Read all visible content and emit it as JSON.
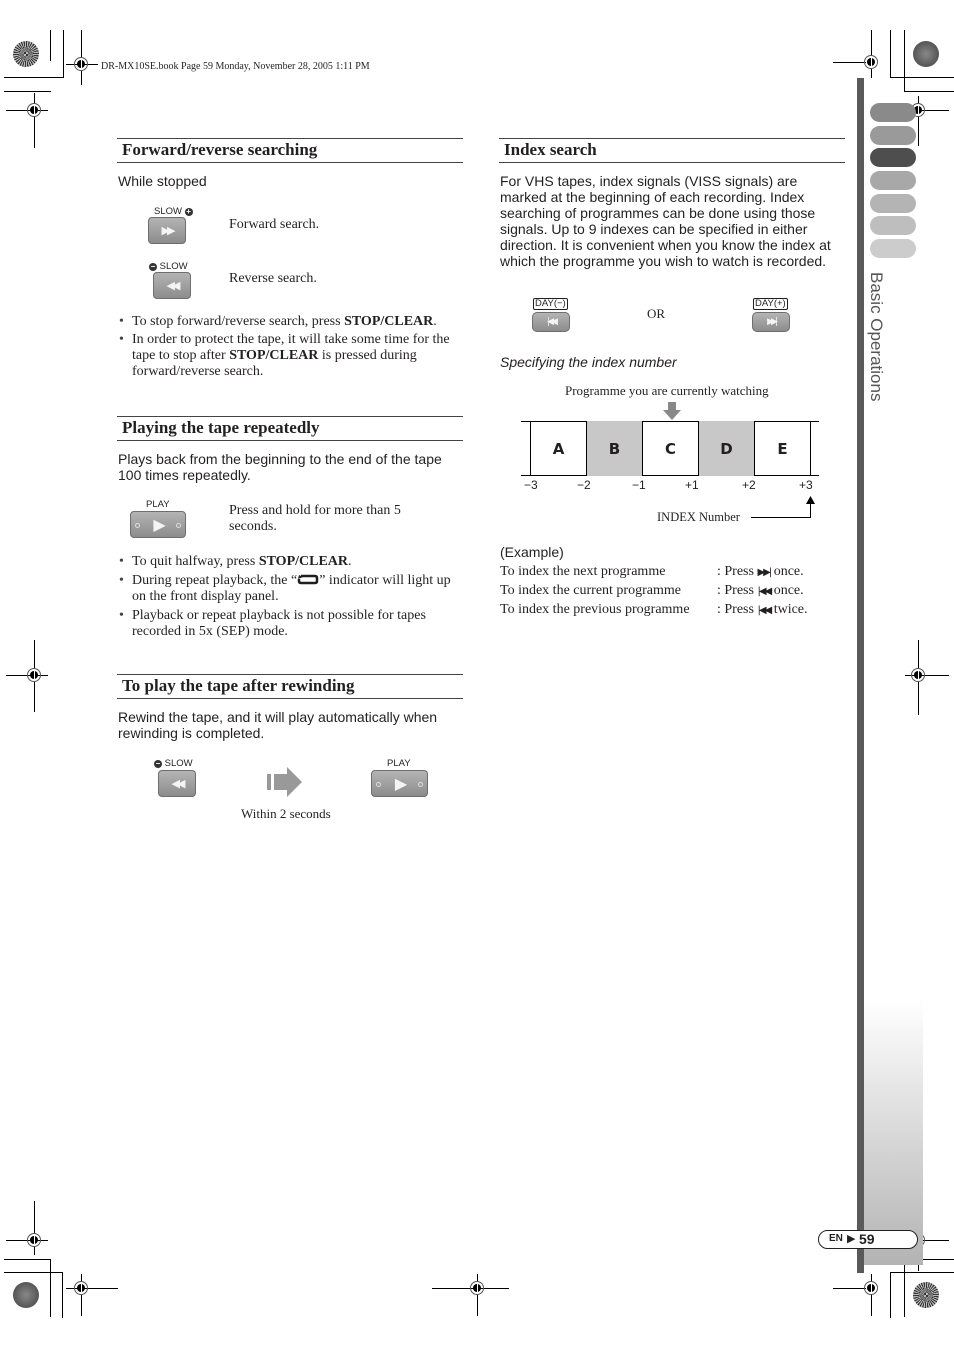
{
  "book_header": "DR-MX10SE.book  Page 59  Monday, November 28, 2005  1:11 PM",
  "side_tab": {
    "title": "Basic Operations",
    "pill_colors": [
      "#8a8a8a",
      "#9a9a9a",
      "#4e4e4e",
      "#a8a8a8",
      "#b4b4b4",
      "#bebebe",
      "#cccccc"
    ]
  },
  "page_footer": {
    "lang": "EN",
    "arrow": "▶",
    "page": "59"
  },
  "forward_reverse": {
    "heading": "Forward/reverse searching",
    "intro": "While stopped",
    "buttons": [
      {
        "label": "SLOW",
        "sign": "+",
        "glyph": "▶▶",
        "description": "Forward search."
      },
      {
        "label": "SLOW",
        "sign": "−",
        "glyph": "◀◀",
        "description": "Reverse search."
      }
    ],
    "notes": [
      {
        "pre": "To stop forward/reverse search, press ",
        "kw": "STOP/CLEAR",
        "post": "."
      },
      {
        "pre": "In order to protect the tape, it will take some time for the tape to stop after ",
        "kw": "STOP/CLEAR",
        "post": " is pressed during forward/reverse search."
      }
    ]
  },
  "repeat": {
    "heading": "Playing the tape repeatedly",
    "intro": "Plays back from the beginning to the end of the tape 100 times repeatedly.",
    "button": {
      "label": "PLAY",
      "glyph": "▶",
      "description": "Press and hold for more than 5 seconds."
    },
    "notes": [
      {
        "pre": "To quit halfway, press ",
        "kw": "STOP/CLEAR",
        "post": "."
      },
      {
        "pre": "During repeat playback, the “",
        "icon": "repeat-icon",
        "post": "” indicator will light up on the front display panel."
      },
      {
        "pre": "Playback or repeat playback is not possible for tapes recorded in 5x (SEP) mode."
      }
    ]
  },
  "after_rewind": {
    "heading": "To play the tape after rewinding",
    "intro": "Rewind the tape, and it will play automatically when rewinding is completed.",
    "rewind_button": {
      "label": "SLOW",
      "sign": "−",
      "glyph": "◀◀"
    },
    "play_button": {
      "label": "PLAY",
      "glyph": "▶"
    },
    "caption": "Within 2 seconds"
  },
  "index_search": {
    "heading": "Index search",
    "intro": "For VHS tapes, index signals (VISS signals) are marked at the beginning of each recording. Index searching of programmes can be done using those signals. Up to 9 indexes can be specified in either direction. It is convenient when you know the index at which the programme you wish to watch is recorded.",
    "prev_button": {
      "label": "DAY(−)",
      "glyph": "|◀◀"
    },
    "or_label": "OR",
    "next_button": {
      "label": "DAY(+)",
      "glyph": "▶▶|"
    },
    "subheading": "Specifying the index number",
    "diagram": {
      "current_label": "Programme you are currently watching",
      "programmes": [
        "A",
        "B",
        "C",
        "D",
        "E"
      ],
      "shaded": [
        false,
        true,
        false,
        true,
        false
      ],
      "index_numbers": [
        "−3",
        "−2",
        "−1",
        "+1",
        "+2",
        "+3"
      ],
      "index_label": "INDEX Number"
    },
    "example": {
      "title": "(Example)",
      "rows": [
        {
          "action": "To index the next programme",
          "press": ": Press",
          "glyph": "▶▶|",
          "count": "once."
        },
        {
          "action": "To index the current programme",
          "press": ": Press",
          "glyph": "|◀◀",
          "count": "once."
        },
        {
          "action": "To index the previous programme",
          "press": ": Press",
          "glyph": "|◀◀",
          "count": "twice."
        }
      ]
    }
  }
}
